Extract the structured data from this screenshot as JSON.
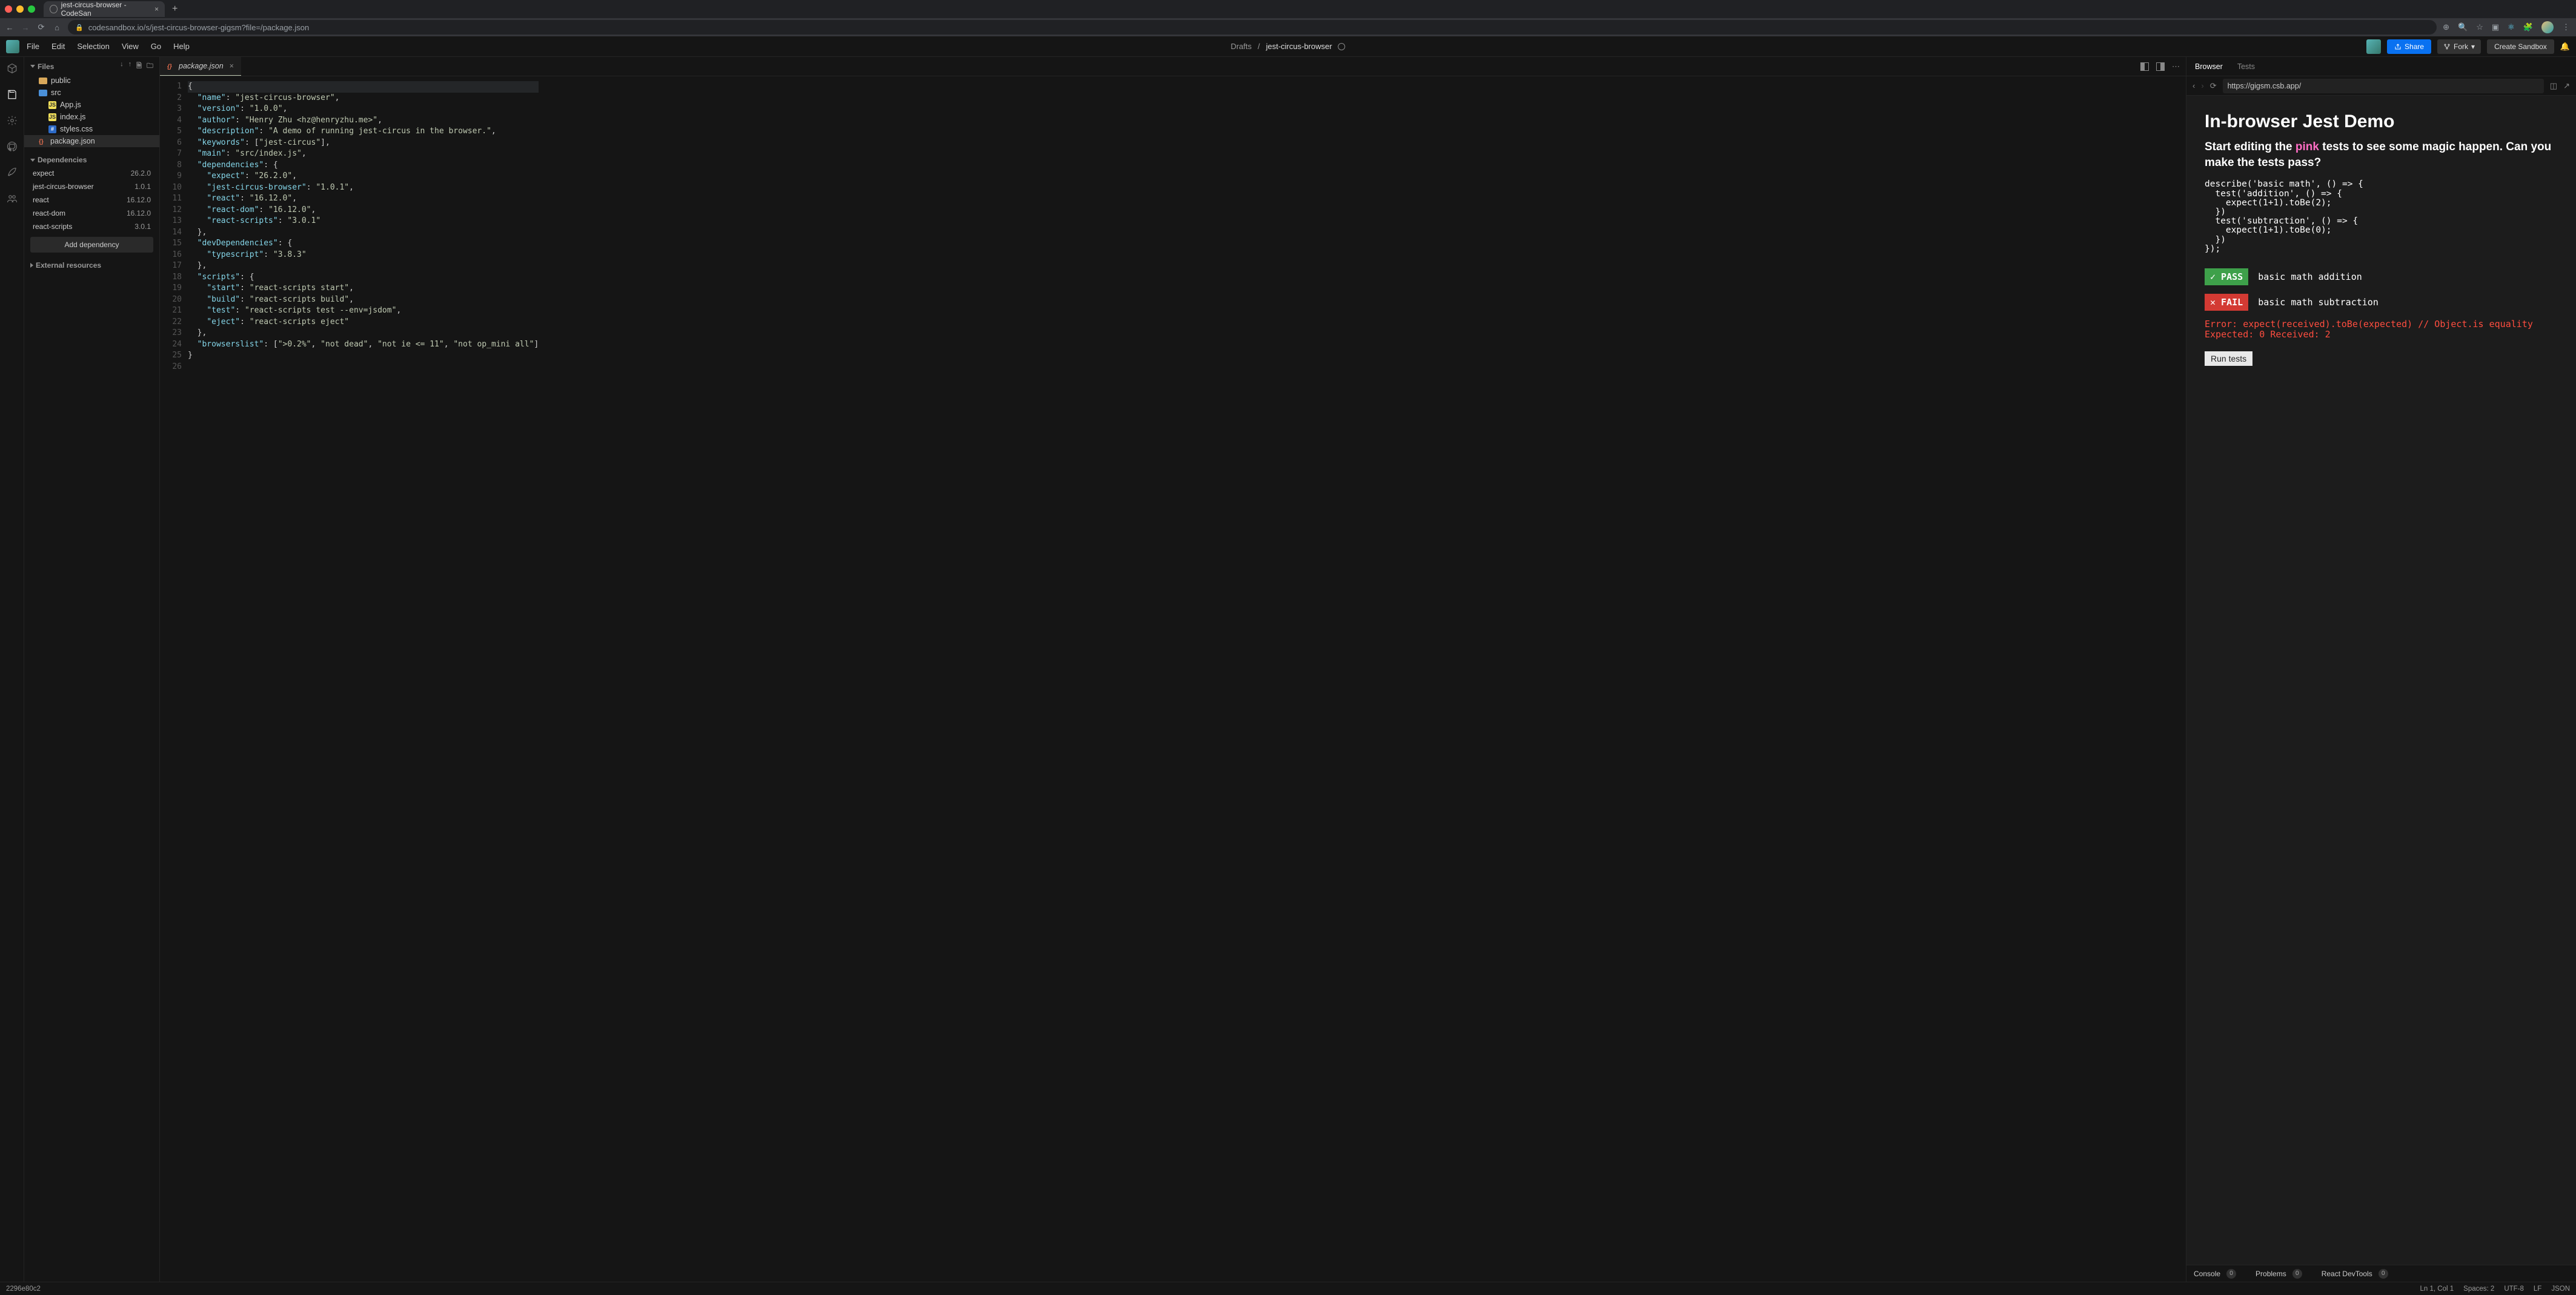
{
  "chrome": {
    "tab_title": "jest-circus-browser - CodeSan",
    "url": "codesandbox.io/s/jest-circus-browser-gigsm?file=/package.json"
  },
  "menu": [
    "File",
    "Edit",
    "Selection",
    "View",
    "Go",
    "Help"
  ],
  "breadcrumb": {
    "drafts": "Drafts",
    "sep": "/",
    "project": "jest-circus-browser"
  },
  "header_buttons": {
    "share": "Share",
    "fork": "Fork",
    "create": "Create Sandbox"
  },
  "explorer": {
    "files_label": "Files",
    "tree": [
      {
        "type": "folder",
        "name": "public",
        "style": "pub",
        "indent": 1
      },
      {
        "type": "folder",
        "name": "src",
        "style": "blue",
        "indent": 1
      },
      {
        "type": "file",
        "name": "App.js",
        "style": "js",
        "indent": 2
      },
      {
        "type": "file",
        "name": "index.js",
        "style": "js",
        "indent": 2
      },
      {
        "type": "file",
        "name": "styles.css",
        "style": "css",
        "indent": 2
      },
      {
        "type": "file",
        "name": "package.json",
        "style": "json",
        "indent": 1,
        "selected": true
      }
    ],
    "deps_label": "Dependencies",
    "deps": [
      {
        "name": "expect",
        "ver": "26.2.0"
      },
      {
        "name": "jest-circus-browser",
        "ver": "1.0.1"
      },
      {
        "name": "react",
        "ver": "16.12.0"
      },
      {
        "name": "react-dom",
        "ver": "16.12.0"
      },
      {
        "name": "react-scripts",
        "ver": "3.0.1"
      }
    ],
    "add_dep": "Add dependency",
    "ext_label": "External resources"
  },
  "editor_tab": "package.json",
  "code_lines": [
    [
      [
        "p",
        "{"
      ]
    ],
    [
      [
        "p",
        "  "
      ],
      [
        "k",
        "\"name\""
      ],
      [
        "p",
        ": "
      ],
      [
        "s",
        "\"jest-circus-browser\""
      ],
      [
        "p",
        ","
      ]
    ],
    [
      [
        "p",
        "  "
      ],
      [
        "k",
        "\"version\""
      ],
      [
        "p",
        ": "
      ],
      [
        "s",
        "\"1.0.0\""
      ],
      [
        "p",
        ","
      ]
    ],
    [
      [
        "p",
        "  "
      ],
      [
        "k",
        "\"author\""
      ],
      [
        "p",
        ": "
      ],
      [
        "s",
        "\"Henry Zhu <hz@henryzhu.me>\""
      ],
      [
        "p",
        ","
      ]
    ],
    [
      [
        "p",
        "  "
      ],
      [
        "k",
        "\"description\""
      ],
      [
        "p",
        ": "
      ],
      [
        "s",
        "\"A demo of running jest-circus in the browser.\""
      ],
      [
        "p",
        ","
      ]
    ],
    [
      [
        "p",
        "  "
      ],
      [
        "k",
        "\"keywords\""
      ],
      [
        "p",
        ": ["
      ],
      [
        "s",
        "\"jest-circus\""
      ],
      [
        "p",
        "],"
      ]
    ],
    [
      [
        "p",
        "  "
      ],
      [
        "k",
        "\"main\""
      ],
      [
        "p",
        ": "
      ],
      [
        "s",
        "\"src/index.js\""
      ],
      [
        "p",
        ","
      ]
    ],
    [
      [
        "p",
        "  "
      ],
      [
        "k",
        "\"dependencies\""
      ],
      [
        "p",
        ": {"
      ]
    ],
    [
      [
        "p",
        "    "
      ],
      [
        "k",
        "\"expect\""
      ],
      [
        "p",
        ": "
      ],
      [
        "s",
        "\"26.2.0\""
      ],
      [
        "p",
        ","
      ]
    ],
    [
      [
        "p",
        "    "
      ],
      [
        "k",
        "\"jest-circus-browser\""
      ],
      [
        "p",
        ": "
      ],
      [
        "s",
        "\"1.0.1\""
      ],
      [
        "p",
        ","
      ]
    ],
    [
      [
        "p",
        "    "
      ],
      [
        "k",
        "\"react\""
      ],
      [
        "p",
        ": "
      ],
      [
        "s",
        "\"16.12.0\""
      ],
      [
        "p",
        ","
      ]
    ],
    [
      [
        "p",
        "    "
      ],
      [
        "k",
        "\"react-dom\""
      ],
      [
        "p",
        ": "
      ],
      [
        "s",
        "\"16.12.0\""
      ],
      [
        "p",
        ","
      ]
    ],
    [
      [
        "p",
        "    "
      ],
      [
        "k",
        "\"react-scripts\""
      ],
      [
        "p",
        ": "
      ],
      [
        "s",
        "\"3.0.1\""
      ]
    ],
    [
      [
        "p",
        "  },"
      ]
    ],
    [
      [
        "p",
        "  "
      ],
      [
        "k",
        "\"devDependencies\""
      ],
      [
        "p",
        ": {"
      ]
    ],
    [
      [
        "p",
        "    "
      ],
      [
        "k",
        "\"typescript\""
      ],
      [
        "p",
        ": "
      ],
      [
        "s",
        "\"3.8.3\""
      ]
    ],
    [
      [
        "p",
        "  },"
      ]
    ],
    [
      [
        "p",
        "  "
      ],
      [
        "k",
        "\"scripts\""
      ],
      [
        "p",
        ": {"
      ]
    ],
    [
      [
        "p",
        "    "
      ],
      [
        "k",
        "\"start\""
      ],
      [
        "p",
        ": "
      ],
      [
        "s",
        "\"react-scripts start\""
      ],
      [
        "p",
        ","
      ]
    ],
    [
      [
        "p",
        "    "
      ],
      [
        "k",
        "\"build\""
      ],
      [
        "p",
        ": "
      ],
      [
        "s",
        "\"react-scripts build\""
      ],
      [
        "p",
        ","
      ]
    ],
    [
      [
        "p",
        "    "
      ],
      [
        "k",
        "\"test\""
      ],
      [
        "p",
        ": "
      ],
      [
        "s",
        "\"react-scripts test --env=jsdom\""
      ],
      [
        "p",
        ","
      ]
    ],
    [
      [
        "p",
        "    "
      ],
      [
        "k",
        "\"eject\""
      ],
      [
        "p",
        ": "
      ],
      [
        "s",
        "\"react-scripts eject\""
      ]
    ],
    [
      [
        "p",
        "  },"
      ]
    ],
    [
      [
        "p",
        "  "
      ],
      [
        "k",
        "\"browserslist\""
      ],
      [
        "p",
        ": ["
      ],
      [
        "s",
        "\">0.2%\""
      ],
      [
        "p",
        ", "
      ],
      [
        "s",
        "\"not dead\""
      ],
      [
        "p",
        ", "
      ],
      [
        "s",
        "\"not ie <= 11\""
      ],
      [
        "p",
        ", "
      ],
      [
        "s",
        "\"not op_mini all\""
      ],
      [
        "p",
        "]"
      ]
    ],
    [
      [
        "p",
        "}"
      ]
    ],
    [
      [
        "p",
        ""
      ]
    ]
  ],
  "preview": {
    "tabs": {
      "browser": "Browser",
      "tests": "Tests"
    },
    "url": "https://gigsm.csb.app/",
    "h1": "In-browser Jest Demo",
    "h2a": "Start editing the ",
    "h2pink": "pink",
    "h2b": " tests to see some magic happen. Can you make the tests pass?",
    "code": "describe('basic math', () => {\n  test('addition', () => {\n    expect(1+1).toBe(2);\n  })\n  test('subtraction', () => {\n    expect(1+1).toBe(0);\n  })\n});",
    "pass_badge": "✓ PASS",
    "pass_text": "basic math addition",
    "fail_badge": "✕ FAIL",
    "fail_text": "basic math subtraction",
    "error": "Error: expect(received).toBe(expected) // Object.is equality Expected: 0 Received: 2",
    "run": "Run tests",
    "footer": {
      "console": "Console",
      "problems": "Problems",
      "devtools": "React DevTools",
      "zero": "0"
    }
  },
  "status": {
    "hash": "2296e80c2",
    "ln": "Ln 1, Col 1",
    "spaces": "Spaces: 2",
    "enc": "UTF-8",
    "lf": "LF",
    "lang": "JSON"
  }
}
